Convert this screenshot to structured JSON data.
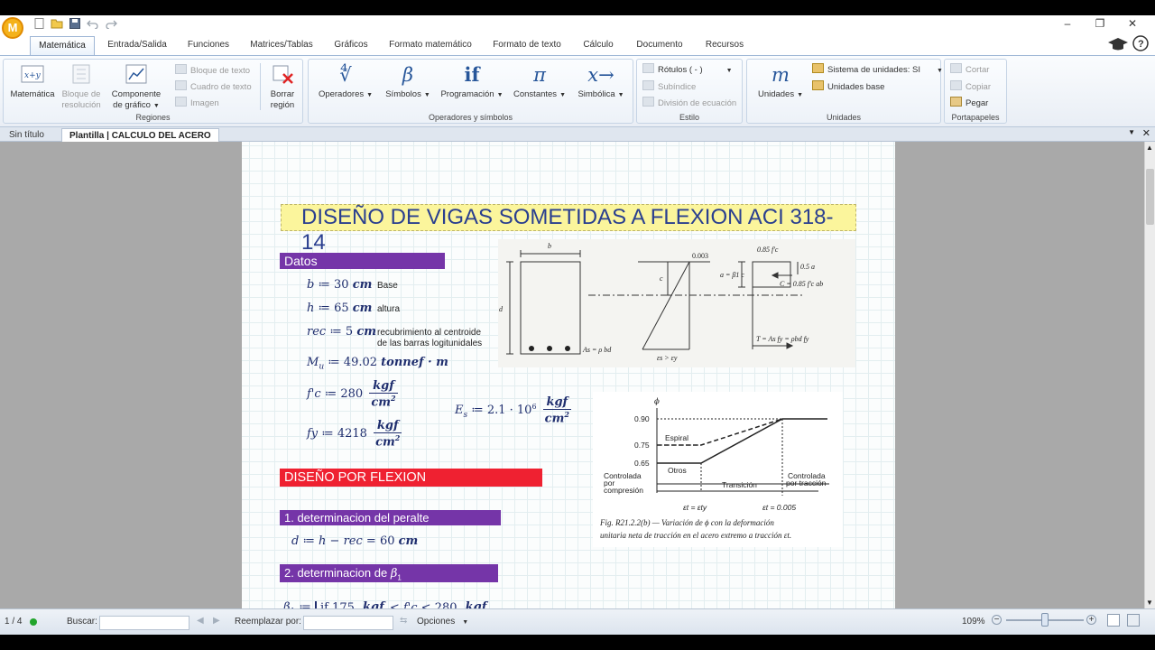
{
  "window": {
    "logo_letter": "M",
    "controls": [
      "–",
      "❐",
      "✕"
    ]
  },
  "ribbon_tabs": [
    "Matemática",
    "Entrada/Salida",
    "Funciones",
    "Matrices/Tablas",
    "Gráficos",
    "Formato matemático",
    "Formato de texto",
    "Cálculo",
    "Documento",
    "Recursos"
  ],
  "ribbon": {
    "regiones": {
      "label": "Regiones",
      "matematica": "Matemática",
      "bloque_resolucion": "Bloque de resolución",
      "componente_grafico": "Componente de gráfico",
      "bloque_texto": "Bloque de texto",
      "cuadro_texto": "Cuadro de texto",
      "imagen": "Imagen",
      "borrar_region": "Borrar región"
    },
    "operadores": {
      "label": "Operadores y símbolos",
      "operadores": "Operadores",
      "simbolos": "Símbolos",
      "programacion": "Programación",
      "constantes": "Constantes",
      "simbolica": "Simbólica"
    },
    "estilo": {
      "label": "Estilo",
      "rotulos": "Rótulos",
      "rotulos_value": "( - )",
      "subindice": "Subíndice",
      "division_ecuacion": "División de ecuación"
    },
    "unidades": {
      "label": "Unidades",
      "unidades": "Unidades",
      "sistema_label": "Sistema de unidades:",
      "sistema_value": "SI",
      "unidades_base": "Unidades base"
    },
    "portapapeles": {
      "label": "Portapapeles",
      "cortar": "Cortar",
      "copiar": "Copiar",
      "pegar": "Pegar"
    }
  },
  "doc_tabs": [
    "Sin título",
    "Plantilla | CALCULO DEL ACERO"
  ],
  "document": {
    "title": "DISEÑO DE VIGAS SOMETIDAS A FLEXION ACI 318-14",
    "sec_datos": "Datos",
    "b_note": "Base",
    "h_note": "altura",
    "rec_note_1": "recubrimiento al centroide",
    "rec_note_2": "de las barras logitunidales",
    "sec_diseno": "DISEÑO POR FLEXION",
    "sec_peralte": "1. determinacion del peralte",
    "sec_beta": "2. determinacion de",
    "sec_beta_sym": "β",
    "sec_beta_sub": "1",
    "beam_fig": {
      "b": "b",
      "d": "d",
      "c": "c",
      "strain": "0.003",
      "as_label": "As = ρ bd",
      "eps_label": "εs > εy",
      "fc_label": "0.85 f'c",
      "a_label": "a = β1 c",
      "half_a": "0.5 a",
      "c_force": "C = 0.85 f'c ab",
      "t_force": "T = As fy = ρbd fy"
    },
    "phi_fig": {
      "phi": "ϕ",
      "y090": "0.90",
      "y075": "0.75",
      "y065": "0.65",
      "espiral": "Espiral",
      "otros": "Otros",
      "controlada_compresion": [
        "Controlada",
        "por",
        "compresión"
      ],
      "transicion": "Transición",
      "controlada_traccion": [
        "Controlada",
        "por tracción"
      ],
      "eps_ty": "εt = εty",
      "eps_0005": "εt = 0.005",
      "caption_1": "Fig.  R21.2.2(b) — Variación de ϕ con la deformación",
      "caption_2": "unitaria neta de tracción en el acero extremo a tracción εt."
    }
  },
  "status": {
    "page": "1 / 4",
    "buscar": "Buscar:",
    "reemplazar": "Reemplazar por:",
    "opciones": "Opciones",
    "zoom": "109%"
  },
  "colors": {
    "accent": "#2a3f8f",
    "section_purple": "#7535a8",
    "section_red": "#ef2131",
    "title_bg": "#fbf59c"
  }
}
